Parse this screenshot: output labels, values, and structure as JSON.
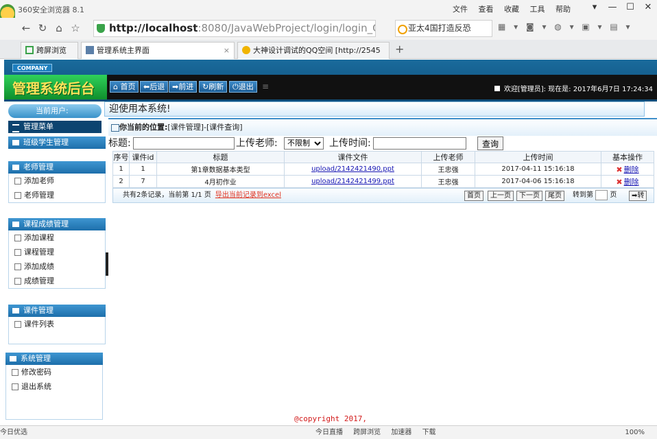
{
  "browser": {
    "app_name": "360安全浏览器 8.1",
    "menus": [
      "文件",
      "查看",
      "收藏",
      "工具",
      "帮助"
    ],
    "window_controls": [
      "▾",
      "—",
      "☐",
      "✕"
    ],
    "url_host": "http://localhost",
    "url_rest": ":8080/JavaWebProject/login/login_Che",
    "search_text": "亚太4国打造反恐",
    "tabs": [
      {
        "label": "跨屏浏览",
        "icon_color": "#3aa34a"
      },
      {
        "label": "管理系统主界面",
        "icon_color": "#5b7fa8"
      },
      {
        "label": "大神设计调试的QQ空间 [http://2545",
        "icon_color": "#f0b400"
      }
    ],
    "tab_close": "×",
    "new_tab": "+",
    "status_left": "今日优选",
    "status_items": [
      "今日直播",
      "跨屏浏览",
      "加速器",
      "下载"
    ],
    "zoom": "100%"
  },
  "header": {
    "company": "COMPANY",
    "brand": "管理系统后台",
    "nav": [
      "首页",
      "后退",
      "前进",
      "刷新",
      "退出"
    ],
    "welcome": "欢迎[管理员]:   现在是: 2017年6月7日 17:24:34"
  },
  "sidebar": {
    "user_label": "当前用户:",
    "menu_title": "管理菜单",
    "groups": [
      {
        "title": "班级学生管理",
        "items": []
      },
      {
        "title": "老师管理",
        "items": [
          "添加老师",
          "老师管理"
        ]
      },
      {
        "title": "课程成绩管理",
        "items": [
          "添加课程",
          "课程管理",
          "添加成绩",
          "成绩管理"
        ]
      },
      {
        "title": "课件管理",
        "items": [
          "课件列表"
        ]
      },
      {
        "title": "系统管理",
        "items": [
          "修改密码",
          "退出系统"
        ]
      }
    ]
  },
  "main": {
    "marquee": "迎使用本系统!",
    "crumb_label": "你当前的位置:",
    "crumb_path": "[课件管理]-[课件查询]",
    "search": {
      "title_label": "标题:",
      "teacher_label": "上传老师:",
      "teacher_selected": "不限制",
      "time_label": "上传时间:",
      "button": "查询"
    },
    "table": {
      "headers": [
        "序号",
        "课件id",
        "标题",
        "课件文件",
        "上传老师",
        "上传时间",
        "基本操作"
      ],
      "rows": [
        {
          "no": "1",
          "id": "1",
          "title": "第1章数据基本类型",
          "file": "upload/2142421490.ppt",
          "teacher": "王忠强",
          "time": "2017-04-11 15:16:18",
          "action": "删除"
        },
        {
          "no": "2",
          "id": "7",
          "title": "4月初作业",
          "file": "upload/2142421499.ppt",
          "teacher": "王忠强",
          "time": "2017-04-06 15:16:18",
          "action": "删除"
        }
      ]
    },
    "pager": {
      "info": "共有2条记录，当前第 1/1 页",
      "export": "导出当前记录到excel",
      "buttons": [
        "首页",
        "上一页",
        "下一页",
        "尾页"
      ],
      "jump_label": "转到第",
      "page_unit": "页",
      "go": "➡转"
    }
  },
  "footer": "@copyright 2017,"
}
